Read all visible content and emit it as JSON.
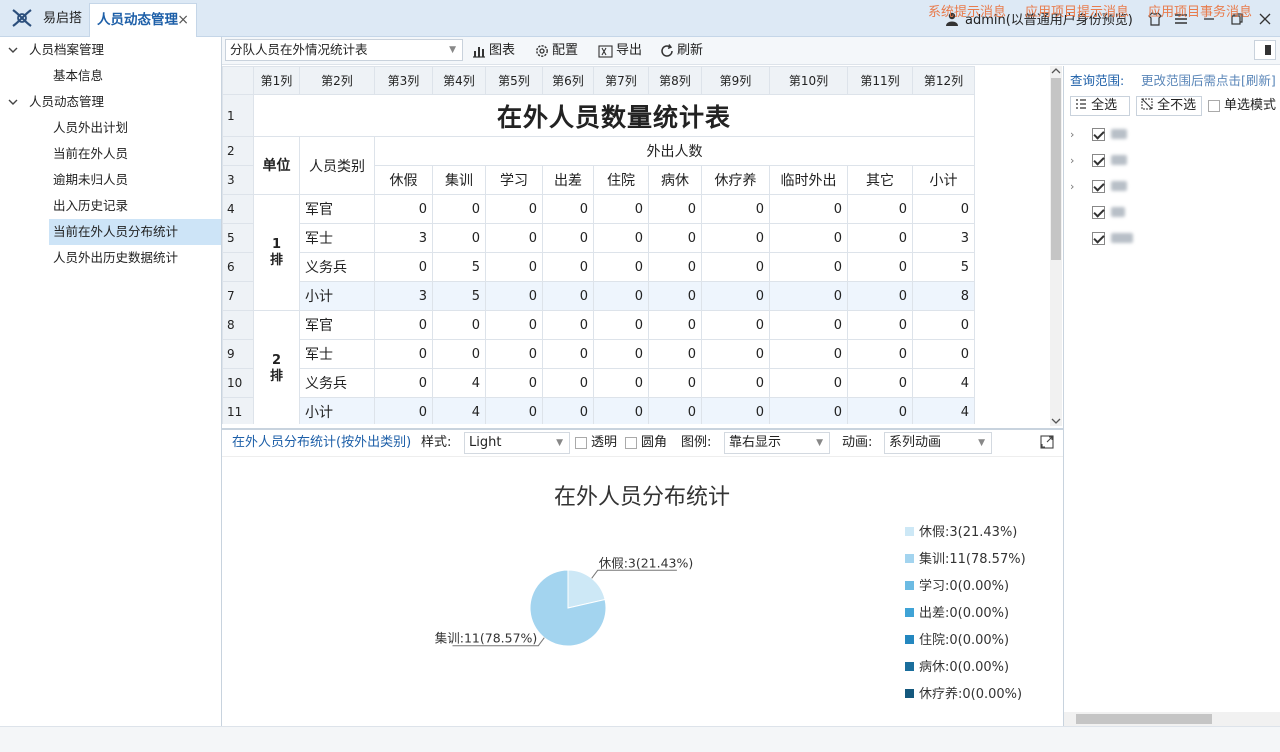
{
  "app": {
    "name": "易启搭",
    "active_tab": "人员动态管理",
    "close_symbol": "×"
  },
  "user": {
    "label": "admin(以普通用户身份预览)"
  },
  "sidebar": {
    "groups": [
      {
        "label": "人员档案管理",
        "items": [
          "基本信息"
        ]
      },
      {
        "label": "人员动态管理",
        "items": [
          "人员外出计划",
          "当前在外人员",
          "逾期未归人员",
          "出入历史记录",
          "当前在外人员分布统计",
          "人员外出历史数据统计"
        ]
      }
    ],
    "selected": "当前在外人员分布统计"
  },
  "toolbar": {
    "report_select": "分队人员在外情况统计表",
    "chart_label": "图表",
    "config_label": "配置",
    "export_label": "导出",
    "refresh_label": "刷新"
  },
  "grid": {
    "col_headers": [
      "第1列",
      "第2列",
      "第3列",
      "第4列",
      "第5列",
      "第6列",
      "第7列",
      "第8列",
      "第9列",
      "第10列",
      "第11列",
      "第12列"
    ],
    "row_numbers": [
      "1",
      "2",
      "3",
      "4",
      "5",
      "6",
      "7",
      "8",
      "9",
      "10",
      "11"
    ],
    "title": "在外人员数量统计表",
    "unit_header": "单位",
    "type_header": "人员类别",
    "out_header": "外出人数",
    "categories": [
      "休假",
      "集训",
      "学习",
      "出差",
      "住院",
      "病休",
      "休疗养",
      "临时外出",
      "其它",
      "小计"
    ],
    "units": [
      {
        "name_line1": "1",
        "name_line2": "排",
        "rows": [
          {
            "type": "军官",
            "values": [
              "0",
              "0",
              "0",
              "0",
              "0",
              "0",
              "0",
              "0",
              "0",
              "0"
            ]
          },
          {
            "type": "军士",
            "values": [
              "3",
              "0",
              "0",
              "0",
              "0",
              "0",
              "0",
              "0",
              "0",
              "3"
            ]
          },
          {
            "type": "义务兵",
            "values": [
              "0",
              "5",
              "0",
              "0",
              "0",
              "0",
              "0",
              "0",
              "0",
              "5"
            ]
          },
          {
            "type": "小计",
            "values": [
              "3",
              "5",
              "0",
              "0",
              "0",
              "0",
              "0",
              "0",
              "0",
              "8"
            ]
          }
        ]
      },
      {
        "name_line1": "2",
        "name_line2": "排",
        "rows": [
          {
            "type": "军官",
            "values": [
              "0",
              "0",
              "0",
              "0",
              "0",
              "0",
              "0",
              "0",
              "0",
              "0"
            ]
          },
          {
            "type": "军士",
            "values": [
              "0",
              "0",
              "0",
              "0",
              "0",
              "0",
              "0",
              "0",
              "0",
              "0"
            ]
          },
          {
            "type": "义务兵",
            "values": [
              "0",
              "4",
              "0",
              "0",
              "0",
              "0",
              "0",
              "0",
              "0",
              "4"
            ]
          },
          {
            "type": "小计",
            "values": [
              "0",
              "4",
              "0",
              "0",
              "0",
              "0",
              "0",
              "0",
              "0",
              "4"
            ]
          }
        ]
      }
    ]
  },
  "chart_panel": {
    "link": "在外人员分布统计(按外出类别)",
    "style_label": "样式:",
    "style_value": "Light",
    "transparent_label": "透明",
    "rounded_label": "圆角",
    "legend_label": "图例:",
    "legend_value": "靠右显示",
    "animation_label": "动画:",
    "animation_value": "系列动画"
  },
  "chart_data": {
    "type": "pie",
    "title": "在外人员分布统计",
    "categories": [
      "休假",
      "集训",
      "学习",
      "出差",
      "住院",
      "病休",
      "休疗养"
    ],
    "values": [
      3,
      11,
      0,
      0,
      0,
      0,
      0
    ],
    "legend_labels": [
      "休假:3(21.43%)",
      "集训:11(78.57%)",
      "学习:0(0.00%)",
      "出差:0(0.00%)",
      "住院:0(0.00%)",
      "病休:0(0.00%)",
      "休疗养:0(0.00%)"
    ],
    "slice_labels": [
      "休假:3(21.43%)",
      "集训:11(78.57%)"
    ],
    "colors": [
      "#cde8f6",
      "#a3d4ef",
      "#6cbbe3",
      "#3fa3d6",
      "#2487bf",
      "#1a6e9c",
      "#14587d"
    ],
    "legend": "right"
  },
  "right_panel": {
    "scope_label": "查询范围:",
    "scope_hint": "更改范围后需点击[刷新]",
    "select_all": "全选",
    "select_none": "全不选",
    "single_mode": "单选模式"
  },
  "status": {
    "items": [
      "系统提示消息",
      "应用项目提示消息",
      "应用项目事务消息"
    ]
  }
}
